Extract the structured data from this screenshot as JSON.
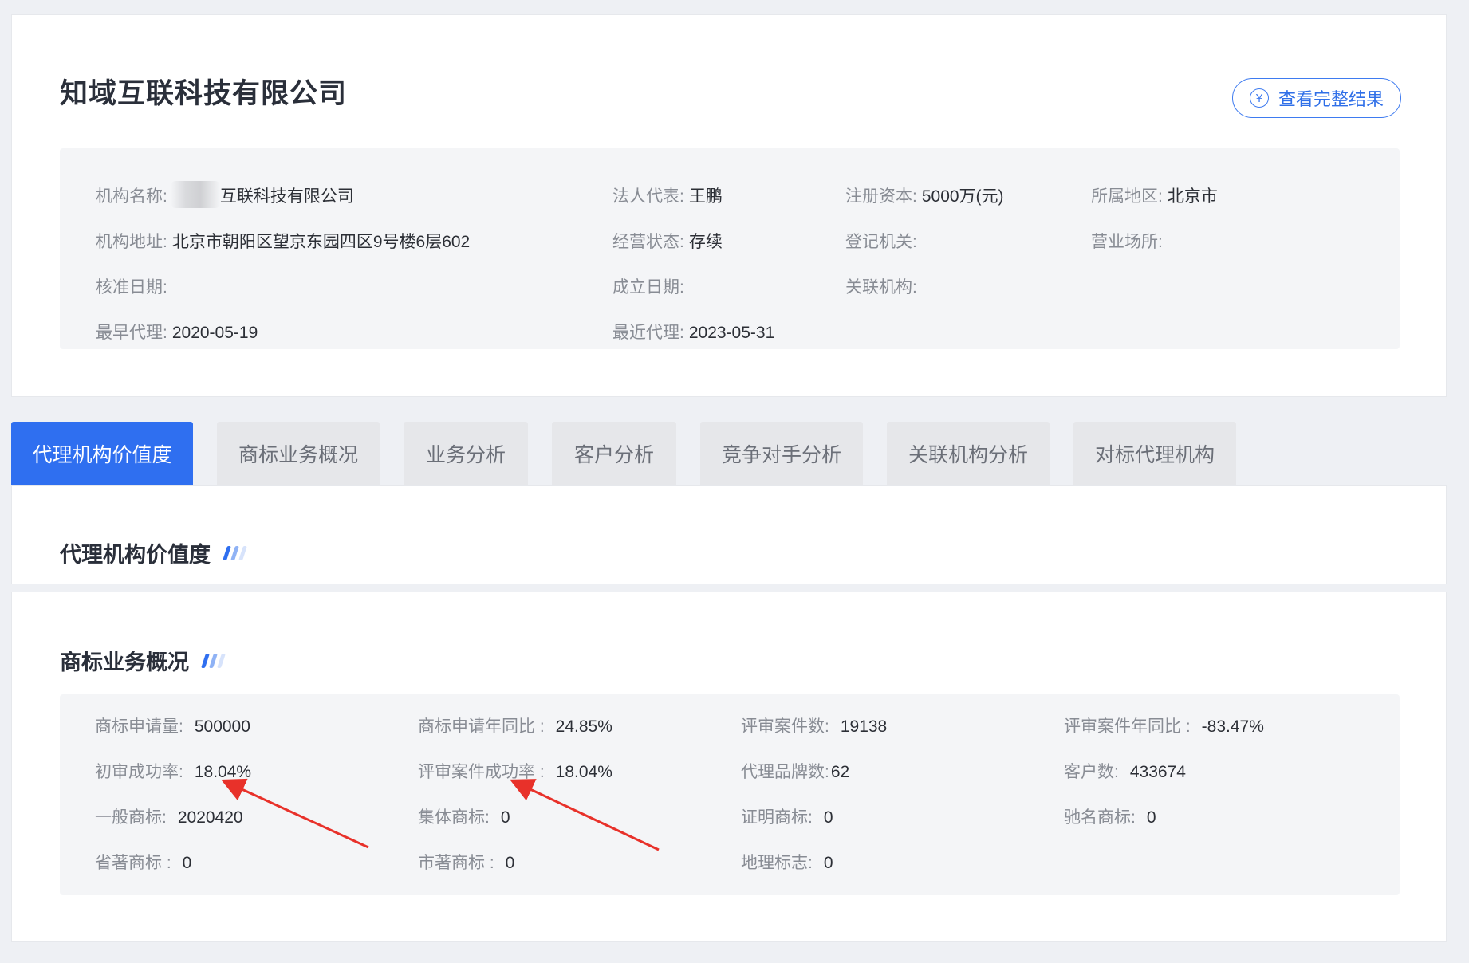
{
  "company": {
    "title": "知域互联科技有限公司",
    "full_result_label": "查看完整结果",
    "fields": {
      "org_name": {
        "label": "机构名称:",
        "value": "互联科技有限公司"
      },
      "legal_rep": {
        "label": "法人代表:",
        "value": "王鹏"
      },
      "reg_capital": {
        "label": "注册资本:",
        "value": "5000万(元)"
      },
      "region": {
        "label": "所属地区:",
        "value": "北京市"
      },
      "address": {
        "label": "机构地址:",
        "value": "北京市朝阳区望京东园四区9号楼6层602"
      },
      "status": {
        "label": "经营状态:",
        "value": "存续"
      },
      "reg_authority": {
        "label": "登记机关:",
        "value": ""
      },
      "business_place": {
        "label": "营业场所:",
        "value": ""
      },
      "approval_date": {
        "label": "核准日期:",
        "value": ""
      },
      "found_date": {
        "label": "成立日期:",
        "value": ""
      },
      "related_org": {
        "label": "关联机构:",
        "value": ""
      },
      "earliest_agent": {
        "label": "最早代理:",
        "value": "2020-05-19"
      },
      "latest_agent": {
        "label": "最近代理:",
        "value": "2023-05-31"
      }
    }
  },
  "tabs": [
    "代理机构价值度",
    "商标业务概况",
    "业务分析",
    "客户分析",
    "竞争对手分析",
    "关联机构分析",
    "对标代理机构"
  ],
  "value_section": {
    "title": "代理机构价值度"
  },
  "trademark_section": {
    "title": "商标业务概况",
    "stats": {
      "apply_count": {
        "label": "商标申请量:",
        "value": "500000"
      },
      "apply_yoy": {
        "label": "商标申请年同比 :",
        "value": "24.85%"
      },
      "review_count": {
        "label": "评审案件数:",
        "value": "19138"
      },
      "review_yoy": {
        "label": "评审案件年同比 :",
        "value": "-83.47%"
      },
      "first_success": {
        "label": "初审成功率:",
        "value": "18.04%"
      },
      "review_success": {
        "label": "评审案件成功率 :",
        "value": "18.04%"
      },
      "brand_count": {
        "label": "代理品牌数:",
        "value": "62"
      },
      "client_count": {
        "label": "客户数:",
        "value": "433674"
      },
      "general_tm": {
        "label": "一般商标:",
        "value": "2020420"
      },
      "collective_tm": {
        "label": "集体商标:",
        "value": "0"
      },
      "cert_tm": {
        "label": "证明商标:",
        "value": "0"
      },
      "famous_tm": {
        "label": "驰名商标:",
        "value": "0"
      },
      "provincial_tm": {
        "label": "省著商标 :",
        "value": "0"
      },
      "city_tm": {
        "label": "市著商标 :",
        "value": "0"
      },
      "geo_mark": {
        "label": "地理标志:",
        "value": "0"
      }
    }
  },
  "colors": {
    "accent": "#2f6ff0",
    "annotation_arrow": "#e8312a"
  }
}
